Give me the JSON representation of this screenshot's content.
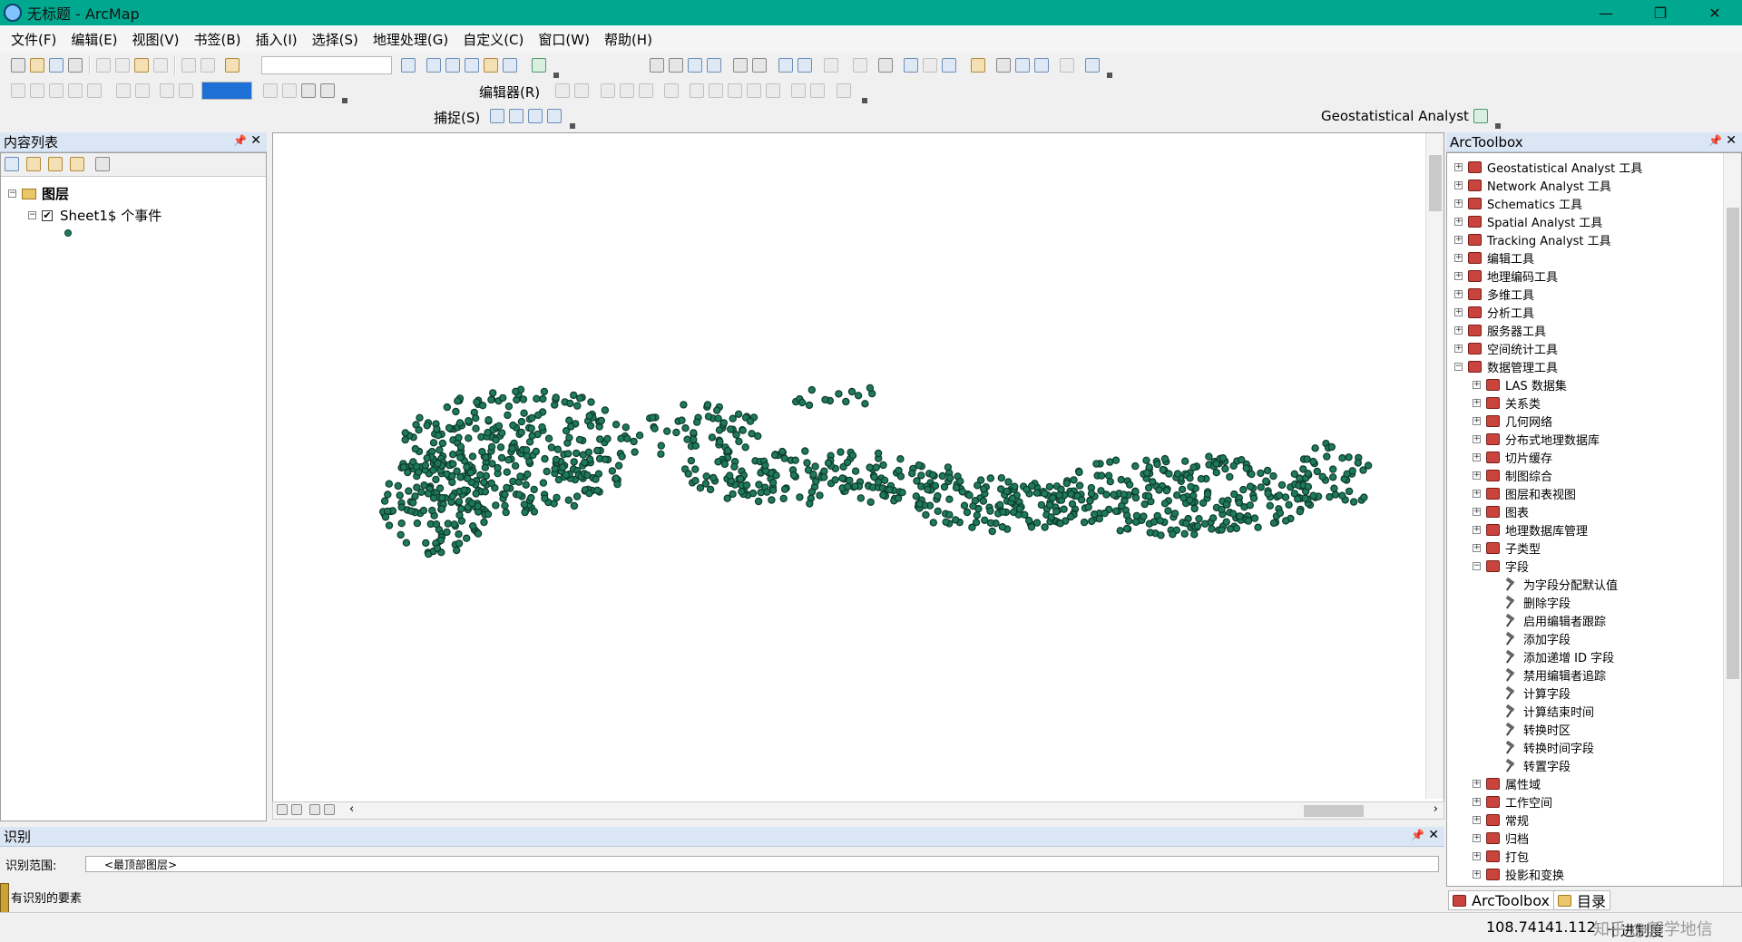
{
  "window": {
    "title": "无标题 - ArcMap",
    "minimize": "—",
    "restore": "❐",
    "close": "✕"
  },
  "menu": [
    "文件(F)",
    "编辑(E)",
    "视图(V)",
    "书签(B)",
    "插入(I)",
    "选择(S)",
    "地理处理(G)",
    "自定义(C)",
    "窗口(W)",
    "帮助(H)"
  ],
  "toolbars": {
    "editor_label": "编辑器(R)",
    "snapping_label": "捕捉(S)",
    "geostat_label": "Geostatistical Analyst",
    "scale_value": ""
  },
  "toc": {
    "title": "内容列表",
    "layers_label": "图层",
    "layer_name": "Sheet1$ 个事件",
    "layer_checked": "✔"
  },
  "toolbox": {
    "title": "ArcToolbox",
    "top_items": [
      "Geostatistical Analyst 工具",
      "Network Analyst 工具",
      "Schematics 工具",
      "Spatial Analyst 工具",
      "Tracking Analyst 工具",
      "编辑工具",
      "地理编码工具",
      "多维工具",
      "分析工具",
      "服务器工具",
      "空间统计工具",
      "数据管理工具"
    ],
    "dm_items": [
      "LAS 数据集",
      "关系类",
      "几何网络",
      "分布式地理数据库",
      "切片缓存",
      "制图综合",
      "图层和表视图",
      "图表",
      "地理数据库管理",
      "子类型",
      "字段"
    ],
    "field_tools": [
      "为字段分配默认值",
      "删除字段",
      "启用编辑者跟踪",
      "添加字段",
      "添加递增 ID 字段",
      "禁用编辑者追踪",
      "计算字段",
      "计算结束时间",
      "转换时区",
      "转换时间字段",
      "转置字段"
    ],
    "after_items": [
      "属性域",
      "工作空间",
      "常规",
      "归档",
      "打包",
      "投影和变换"
    ],
    "tabs": [
      "ArcToolbox",
      "目录"
    ]
  },
  "identify": {
    "title": "识别",
    "range_label": "识别范围:",
    "range_value": "<最顶部图层>",
    "no_result": "有识别的要素"
  },
  "status": {
    "x": "108.741",
    "y": "41.112",
    "unit": "十进制度",
    "watermark": "知乎 @郭学地信"
  },
  "colors": {
    "title_bar": "#00a88f",
    "point_fill": "#1f7a5c",
    "point_stroke": "#0d3b2c",
    "panel_header": "#dbe6f4"
  }
}
